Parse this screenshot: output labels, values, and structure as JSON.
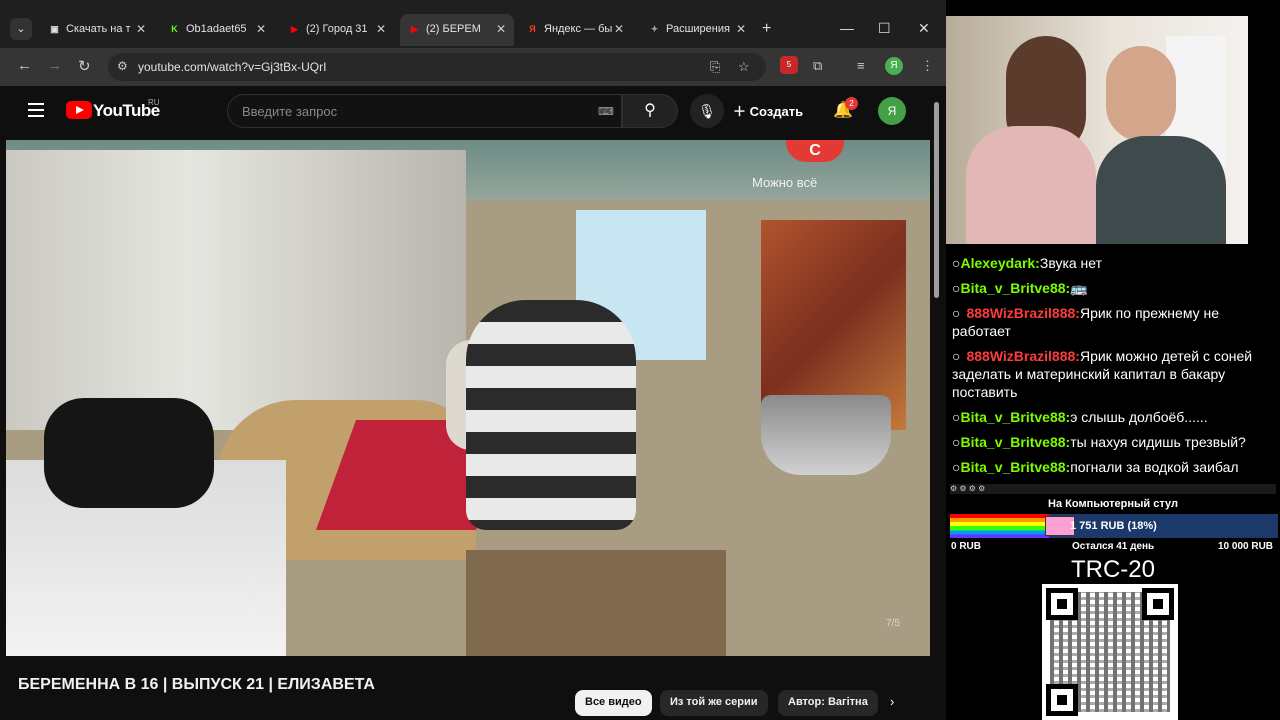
{
  "browser": {
    "tabs": [
      {
        "label": "Скачать на т",
        "favicon_color": "#e0e0e0",
        "favicon_glyph": "▣",
        "active": false
      },
      {
        "label": "Ob1adaet65",
        "favicon_color": "#53fc18",
        "favicon_glyph": "K",
        "active": false
      },
      {
        "label": "(2) Город 31",
        "favicon_color": "#ff0000",
        "favicon_glyph": "▶",
        "active": false
      },
      {
        "label": "(2) БЕРЕМ",
        "favicon_color": "#ff0000",
        "favicon_glyph": "▶",
        "active": true
      },
      {
        "label": "Яндекс — бы",
        "favicon_color": "#fc3f1d",
        "favicon_glyph": "Я",
        "active": false
      },
      {
        "label": "Расширения",
        "favicon_color": "#9e9e9e",
        "favicon_glyph": "✦",
        "active": false
      }
    ],
    "url": "youtube.com/watch?v=Gj3tBx-UQrI",
    "extension_badge": "5",
    "profile_initial": "Я"
  },
  "youtube": {
    "logo_text": "YouTube",
    "region": "RU",
    "search_placeholder": "Введите запрос",
    "create_label": "Создать",
    "notifications_count": "2",
    "avatar_initial": "Я",
    "video": {
      "channel_logo": "С",
      "channel_slogan": "Можно всё",
      "watermark": "7/5"
    },
    "video_title": "БЕРЕМЕННА В 16 | ВЫПУСК 21 | ЕЛИЗАВЕТА",
    "chips": [
      {
        "label": "Все видео",
        "selected": true
      },
      {
        "label": "Из той же серии",
        "selected": false
      },
      {
        "label": "Автор: Вагітна",
        "selected": false
      }
    ]
  },
  "chat": {
    "messages": [
      {
        "nick": "Alexeydark:",
        "text": "Звука нет",
        "color": "green"
      },
      {
        "nick": "Bita_v_Britve88:",
        "text": "🚌",
        "color": "green"
      },
      {
        "nick": "888WizBrazil888:",
        "text": "Ярик по прежнему не работает",
        "color": "red"
      },
      {
        "nick": "888WizBrazil888:",
        "text": "Ярик можно детей с соней заделать и материнский капитал в бакару поставить",
        "color": "red"
      },
      {
        "nick": "Bita_v_Britve88:",
        "text": "э слышь долбоёб......",
        "color": "green"
      },
      {
        "nick": "Bita_v_Britve88:",
        "text": "ты нахуя сидишь трезвый?",
        "color": "green"
      },
      {
        "nick": "Bita_v_Britve88:",
        "text": "погнали за водкой заибал",
        "color": "green"
      }
    ]
  },
  "goal": {
    "title": "На Компьютерный стул",
    "amount": "1 751 RUB (18%)",
    "progress": 0.18,
    "min_label": "0 RUB",
    "days_left": "Остался 41 день",
    "max_label": "10 000 RUB"
  },
  "donation": {
    "network_label": "TRC-20"
  }
}
